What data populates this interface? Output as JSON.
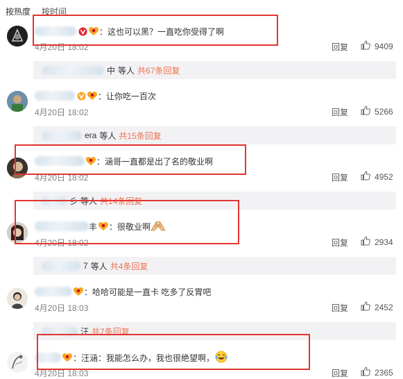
{
  "sort_tabs": [
    {
      "label": "按热度"
    },
    {
      "label": "按时间"
    }
  ],
  "reply_label": "回复",
  "comments": [
    {
      "text": "：这也可以黑？一直吃你受得了啊",
      "time": "4月20日 18:02",
      "likes": "9409",
      "sub_replies": {
        "suffix": "中",
        "people": "等人",
        "count": "共67条回复"
      }
    },
    {
      "text": "：让你吃一百次",
      "time": "4月20日 18:02",
      "likes": "5266",
      "sub_replies": {
        "suffix": "era",
        "people": "等人",
        "count": "共15条回复"
      }
    },
    {
      "text": "：涵哥一直都是出了名的敬业啊",
      "time": "4月20日 18:02",
      "likes": "4952",
      "sub_replies": {
        "suffix": "彡",
        "people": "等人",
        "count": "共14条回复"
      }
    },
    {
      "text": "：很敬业啊",
      "time": "4月20日 18:02",
      "likes": "2934",
      "name_suffix": "丰",
      "sub_replies": {
        "suffix": "7",
        "people": "等人",
        "count": "共4条回复"
      }
    },
    {
      "text": "：哈哈可能是一直卡 吃多了反胃吧",
      "time": "4月20日 18:03",
      "likes": "2452",
      "sub_replies": {
        "suffix": "汪",
        "people": "",
        "count": "共7条回复"
      }
    },
    {
      "text": "：汪涵：我能怎么办，我也很绝望啊，",
      "time": "4月20日 18:03",
      "likes": "2365"
    }
  ],
  "icons": {
    "like": "thumbs-up-icon",
    "vip": "v-badge-icon",
    "fan": "fan-heart-badge-icon"
  },
  "colors": {
    "highlight_box": "#e3342f",
    "reply_count": "#eb7350",
    "sub_bar_bg": "#f2f2f5",
    "meta_text": "#808080"
  }
}
